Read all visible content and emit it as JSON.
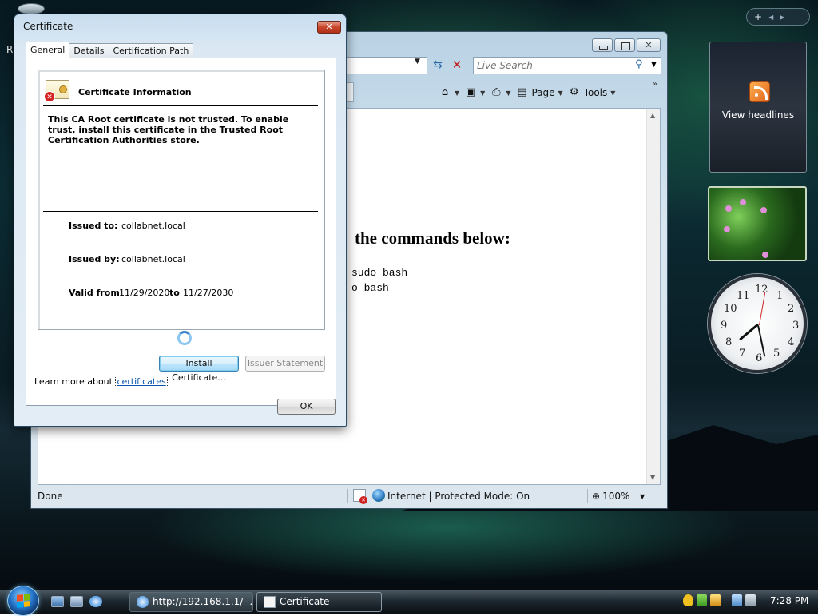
{
  "desktop": {
    "partial_icon_label": "R",
    "sidebar": {
      "add_label": "+",
      "prev_label": "◀",
      "next_label": "▶",
      "feed_gadget": {
        "label": "View headlines"
      }
    }
  },
  "browser": {
    "search": {
      "placeholder": "Live Search"
    },
    "commands": {
      "page_label": "Page",
      "tools_label": "Tools"
    },
    "content": {
      "heading": "the commands below:",
      "code_lines": [
        "sudo bash",
        "o bash"
      ]
    },
    "status": {
      "text": "Done",
      "zone": "Internet | Protected Mode: On",
      "zoom": "100%"
    }
  },
  "dialog": {
    "title": "Certificate",
    "close_label": "✕",
    "tabs": [
      {
        "label": "General",
        "active": true
      },
      {
        "label": "Details",
        "active": false
      },
      {
        "label": "Certification Path",
        "active": false
      }
    ],
    "cert_info_title": "Certificate Information",
    "message": "This CA Root certificate is not trusted. To enable trust, install this certificate in the Trusted Root Certification Authorities store.",
    "issued_to_label": "Issued to:",
    "issued_to": "collabnet.local",
    "issued_by_label": "Issued by:",
    "issued_by": "collabnet.local",
    "valid_from_label": "Valid from",
    "valid_from": "11/29/2020",
    "valid_to_label": "to",
    "valid_to": "11/27/2030",
    "install_button": "Install Certificate...",
    "issuer_statement_button": "Issuer Statement",
    "learn_more_text": "Learn more about",
    "learn_more_link": "certificates",
    "ok_button": "OK"
  },
  "taskbar": {
    "tasks": [
      {
        "label": "http://192.168.1.1/ -...",
        "active": false
      },
      {
        "label": "Certificate",
        "active": true
      }
    ],
    "clock": "7:28 PM"
  }
}
